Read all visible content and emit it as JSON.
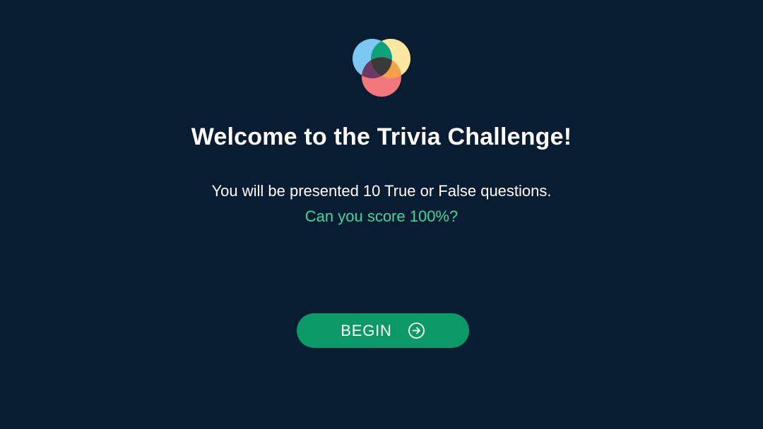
{
  "page": {
    "title": "Welcome to the Trivia Challenge!",
    "subtitle": "You will be presented 10 True or False questions.",
    "tagline": "Can you score 100%?"
  },
  "actions": {
    "begin_label": "BEGIN",
    "begin_icon": "arrow-right-circle-icon"
  },
  "logo": {
    "icon": "overlapping-circles-logo",
    "colors": {
      "blue": "#7cc8f2",
      "yellow": "#fbe7a0",
      "red": "#f3777c",
      "teal": "#0ea27a",
      "purple": "#6b3a63",
      "orange": "#f6a04a",
      "center": "#3a3a3a"
    }
  },
  "theme": {
    "background": "#081d31",
    "accent_text": "#3fd6a0",
    "button": "#0b9a67"
  }
}
